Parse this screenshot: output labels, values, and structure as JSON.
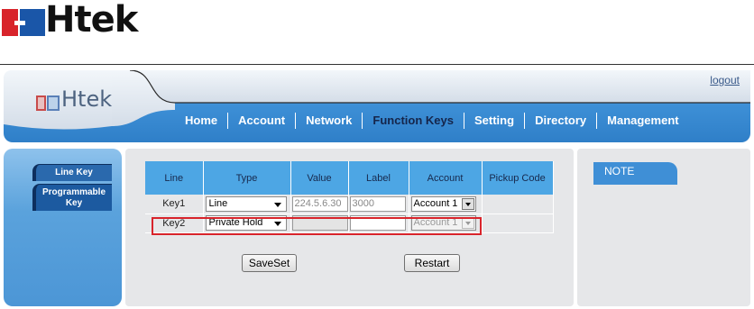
{
  "brand": {
    "name": "Htek",
    "red": "#d8242b",
    "blue": "#1a56a8"
  },
  "header": {
    "logout_label": "logout",
    "nav": [
      {
        "label": "Home",
        "active": false
      },
      {
        "label": "Account",
        "active": false
      },
      {
        "label": "Network",
        "active": false
      },
      {
        "label": "Function Keys",
        "active": true
      },
      {
        "label": "Setting",
        "active": false
      },
      {
        "label": "Directory",
        "active": false
      },
      {
        "label": "Management",
        "active": false
      }
    ]
  },
  "sidebar": {
    "items": [
      {
        "label": "Line Key",
        "active": true
      },
      {
        "label": "Programmable Key",
        "active": false
      }
    ]
  },
  "table": {
    "columns": [
      "Line",
      "Type",
      "Value",
      "Label",
      "Account",
      "Pickup Code"
    ],
    "rows": [
      {
        "line": "Key1",
        "type": "Line",
        "value": "224.5.6.30",
        "label": "3000",
        "account": "Account 1",
        "pickup": ""
      },
      {
        "line": "Key2",
        "type": "Private Hold",
        "value": "",
        "label": "",
        "account": "Account 1",
        "pickup": ""
      }
    ]
  },
  "buttons": {
    "saveset": "SaveSet",
    "restart": "Restart"
  },
  "note": {
    "title": "NOTE"
  }
}
